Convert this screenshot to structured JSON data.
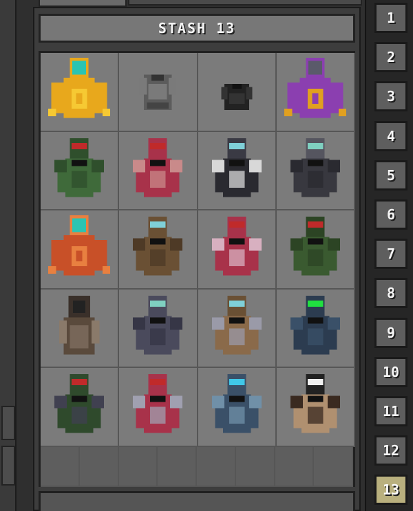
{
  "stash": {
    "title": "STASH 13"
  },
  "tabs": [
    "1",
    "2",
    "3",
    "4",
    "5",
    "6",
    "7",
    "8",
    "9",
    "10",
    "11",
    "12",
    "13"
  ],
  "active_tab": "13",
  "colors": {
    "accent": "#b9b07e",
    "panel": "#7b7b7b",
    "frame": "#202020"
  },
  "items": [
    {
      "name": "hazmat-suit-yellow",
      "body": "#e8a81c",
      "trim": "#f6c933",
      "visor": "#2bc4b2",
      "helm": "#e8a81c",
      "style": "suit"
    },
    {
      "name": "vest-grey",
      "body": "#5c5c5c",
      "trim": "#7a7a7a",
      "visor": "",
      "helm": "",
      "style": "vest"
    },
    {
      "name": "vest-black",
      "body": "#222222",
      "trim": "#333333",
      "visor": "",
      "helm": "",
      "style": "vestsmall"
    },
    {
      "name": "suit-purple",
      "body": "#8b3fb0",
      "trim": "#e0a020",
      "visor": "#5a5a6a",
      "helm": "#8b3fb0",
      "style": "suit"
    },
    {
      "name": "armor-green",
      "body": "#3f6a3a",
      "trim": "#2f4f2c",
      "visor": "#c02a2a",
      "helm": "#2f4f2c",
      "style": "armor"
    },
    {
      "name": "armor-crimson",
      "body": "#a8324a",
      "trim": "#c98a8a",
      "visor": "#c02a2a",
      "helm": "#a8324a",
      "style": "armor"
    },
    {
      "name": "armor-black-swat",
      "body": "#2a2a30",
      "trim": "#d8d8d8",
      "visor": "#7fd0d8",
      "helm": "#3a3a44",
      "style": "armor"
    },
    {
      "name": "armor-dark-grey",
      "body": "#38383f",
      "trim": "#2a2a30",
      "visor": "#7fd0c0",
      "helm": "#55555f",
      "style": "armor"
    },
    {
      "name": "suit-orange",
      "body": "#c85028",
      "trim": "#e88040",
      "visor": "#2bc4b2",
      "helm": "#e88040",
      "style": "suit"
    },
    {
      "name": "armor-brown",
      "body": "#6a5034",
      "trim": "#4e3a26",
      "visor": "#7fd0d8",
      "helm": "#6a5034",
      "style": "armor"
    },
    {
      "name": "armor-red-white",
      "body": "#a8324a",
      "trim": "#d8b0c0",
      "visor": "#c02a2a",
      "helm": "#a8324a",
      "style": "armor"
    },
    {
      "name": "armor-olive",
      "body": "#3a5a30",
      "trim": "#2c4424",
      "visor": "#c02a2a",
      "helm": "#2c4424",
      "style": "armor"
    },
    {
      "name": "hood-tan",
      "body": "#5a4a3c",
      "trim": "#8a7a6a",
      "visor": "#222222",
      "helm": "#3a302a",
      "style": "hood"
    },
    {
      "name": "armor-slate",
      "body": "#4a4a5c",
      "trim": "#363646",
      "visor": "#7fd0c0",
      "helm": "#4a4a5c",
      "style": "armor"
    },
    {
      "name": "armor-tan-spiked",
      "body": "#8a6a4a",
      "trim": "#9a9aa8",
      "visor": "#7fd0d8",
      "helm": "#6a5034",
      "style": "armor"
    },
    {
      "name": "armor-navy",
      "body": "#2c3c50",
      "trim": "#3a5068",
      "visor": "#20e040",
      "helm": "#2c3c50",
      "style": "armor"
    },
    {
      "name": "armor-forest-heavy",
      "body": "#2f4a2c",
      "trim": "#404050",
      "visor": "#c02a2a",
      "helm": "#2f4a2c",
      "style": "armor"
    },
    {
      "name": "armor-crimson-spiked",
      "body": "#a8324a",
      "trim": "#a0a0b0",
      "visor": "#c02a2a",
      "helm": "#a8324a",
      "style": "armor"
    },
    {
      "name": "armor-blue-steel",
      "body": "#3a5068",
      "trim": "#7090a8",
      "visor": "#40c8e8",
      "helm": "#3a5068",
      "style": "armor"
    },
    {
      "name": "armor-tan-k",
      "body": "#b09070",
      "trim": "#3a2a20",
      "visor": "#f0f0f0",
      "helm": "#222222",
      "style": "armor"
    }
  ]
}
